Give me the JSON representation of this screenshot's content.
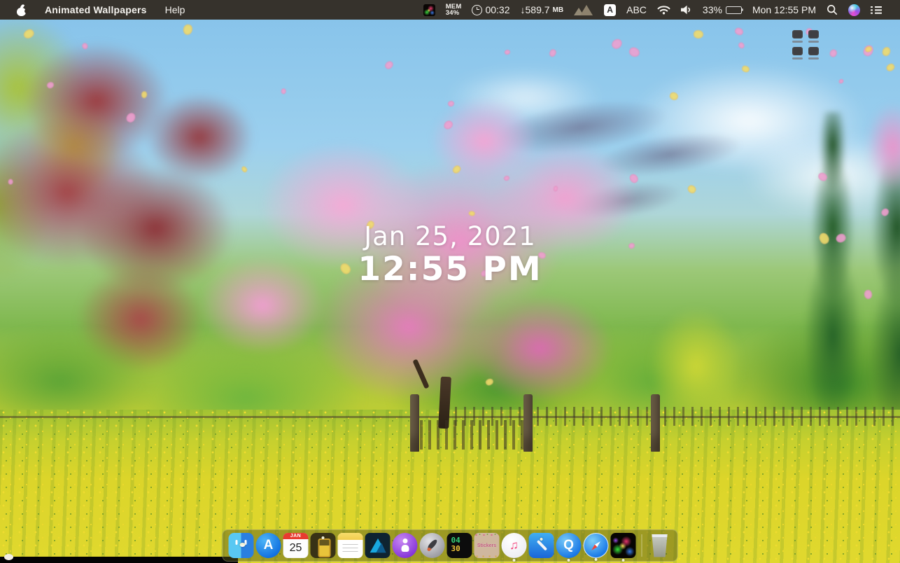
{
  "menu_bar": {
    "app_name": "Animated Wallpapers",
    "menus": [
      "Help"
    ],
    "status": {
      "mem_label": "MEM",
      "mem_value": "34%",
      "timer_value": "00:32",
      "download_value": "↓589.7",
      "download_unit": "MB",
      "input_badge": "A",
      "input_name": "ABC",
      "battery_percent": "33%",
      "clock": "Mon 12:55 PM"
    }
  },
  "overlay": {
    "date": "Jan 25, 2021",
    "time": "12:55 PM"
  },
  "dock": {
    "items": [
      "finder",
      "app-store",
      "calendar",
      "battery",
      "notes",
      "affinity-designer",
      "podcasts",
      "rocket",
      "countdown",
      "stickers",
      "music",
      "xcode",
      "quicktime",
      "safari",
      "animated-wallpapers",
      "trash"
    ],
    "running_apps": [
      "finder",
      "battery",
      "music",
      "xcode",
      "quicktime",
      "safari",
      "animated-wallpapers"
    ],
    "app_store_letter": "A",
    "calendar": {
      "month": "JAN",
      "day": "25"
    },
    "countdown_badge": {
      "top": "04",
      "bottom": "30"
    },
    "stickers_label": "Stickers",
    "music_glyph": "♫",
    "quicktime_letter": "Q"
  },
  "colors": {
    "menubar_bg": "#342d25",
    "petal_pink": "#f0a0d0",
    "petal_yellow": "#f2dc6c",
    "dock_tint": "rgba(86,88,26,0.48)",
    "accent_blue": "#1a7ae8"
  },
  "petals": {
    "count": 46
  }
}
